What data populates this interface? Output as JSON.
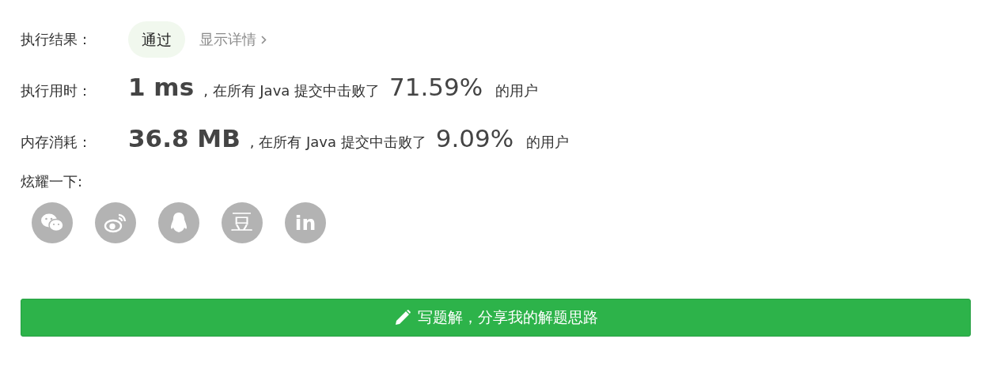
{
  "result": {
    "label": "执行结果：",
    "status": "通过",
    "details_link": "显示详情"
  },
  "metrics": [
    {
      "label": "执行用时：",
      "value": "1 ms",
      "text": ", 在所有 Java 提交中击败了",
      "percent": "71.59%",
      "suffix": "的用户"
    },
    {
      "label": "内存消耗：",
      "value": "36.8 MB",
      "text": ", 在所有 Java 提交中击败了",
      "percent": "9.09%",
      "suffix": "的用户"
    }
  ],
  "share": {
    "label": "炫耀一下:",
    "buttons": [
      {
        "kind": "wechat"
      },
      {
        "kind": "weibo"
      },
      {
        "kind": "qq"
      },
      {
        "kind": "douban",
        "glyph": "豆"
      },
      {
        "kind": "linkedin",
        "glyph": "in"
      }
    ]
  },
  "write_solution_button": "写题解，分享我的解题思路"
}
